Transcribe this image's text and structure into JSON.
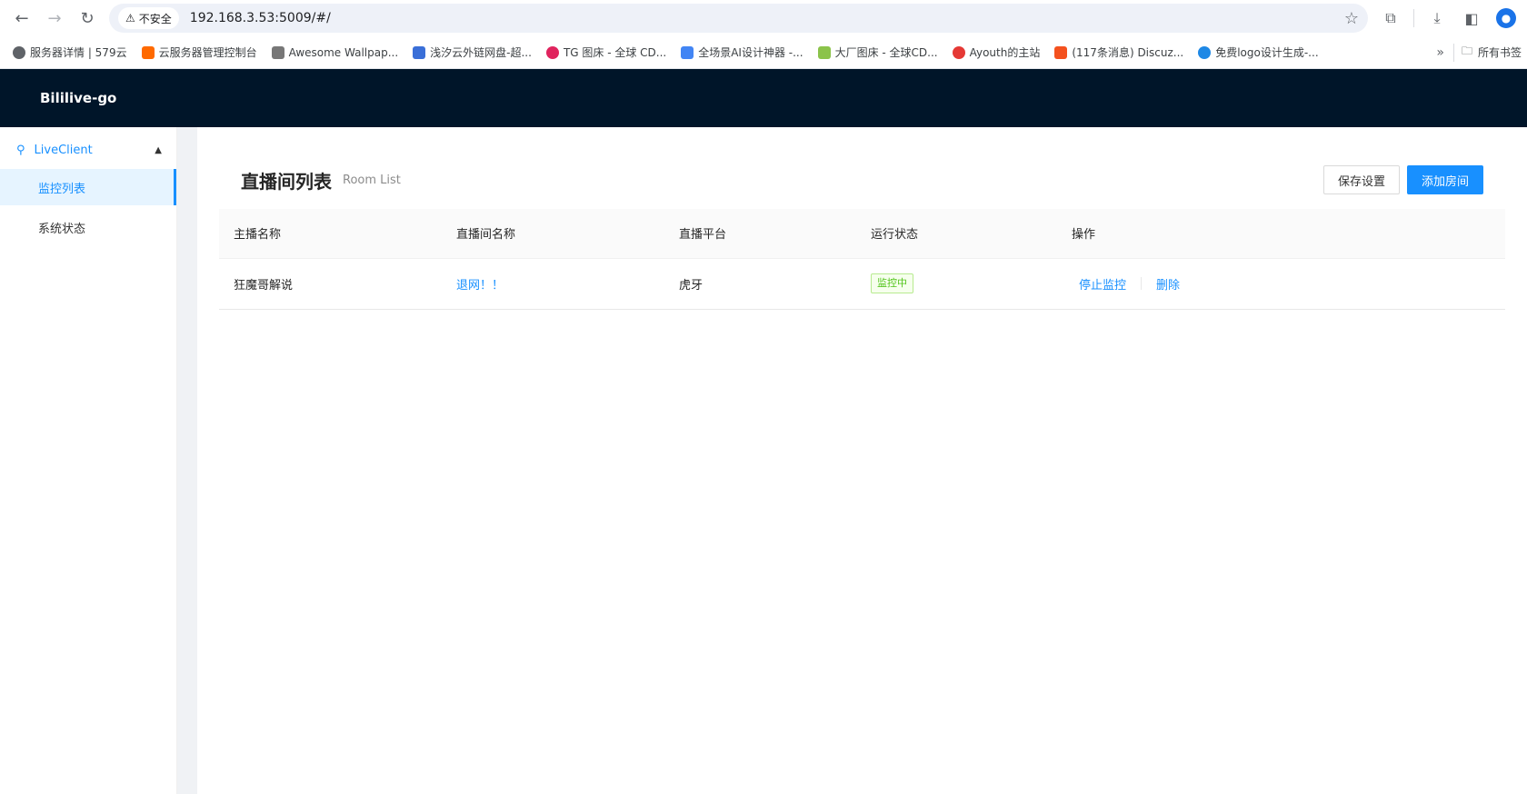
{
  "browser": {
    "security_label": "不安全",
    "url": "192.168.3.53:5009/#/",
    "bookmarks": [
      {
        "label": "服务器详情 | 579云",
        "color": "#5f6368"
      },
      {
        "label": "云服务器管理控制台",
        "color": "#ff6a00"
      },
      {
        "label": "Awesome Wallpap...",
        "color": "#777777"
      },
      {
        "label": "浅汐云外链网盘-超...",
        "color": "#3a6fd8"
      },
      {
        "label": "TG 图床 - 全球 CD...",
        "color": "#e0245e"
      },
      {
        "label": "全场景AI设计神器 -...",
        "color": "#4285f4"
      },
      {
        "label": "大厂图床 - 全球CD...",
        "color": "#8bc34a"
      },
      {
        "label": "Ayouth的主站",
        "color": "#e53935"
      },
      {
        "label": "(117条消息) Discuz...",
        "color": "#f4511e"
      },
      {
        "label": "免费logo设计生成-...",
        "color": "#1e88e5"
      }
    ],
    "bookmark_folder": "所有书签"
  },
  "app": {
    "title": "Bililive-go"
  },
  "sidebar": {
    "group_label": "LiveClient",
    "items": [
      {
        "label": "监控列表",
        "active": true
      },
      {
        "label": "系统状态",
        "active": false
      }
    ]
  },
  "page": {
    "title": "直播间列表",
    "subtitle": "Room List",
    "save_button": "保存设置",
    "add_button": "添加房间"
  },
  "table": {
    "columns": [
      "主播名称",
      "直播间名称",
      "直播平台",
      "运行状态",
      "操作"
    ],
    "rows": [
      {
        "host": "狂魔哥解说",
        "room": "退网！！",
        "platform": "虎牙",
        "status": "监控中",
        "action_stop": "停止监控",
        "action_delete": "删除"
      }
    ]
  }
}
